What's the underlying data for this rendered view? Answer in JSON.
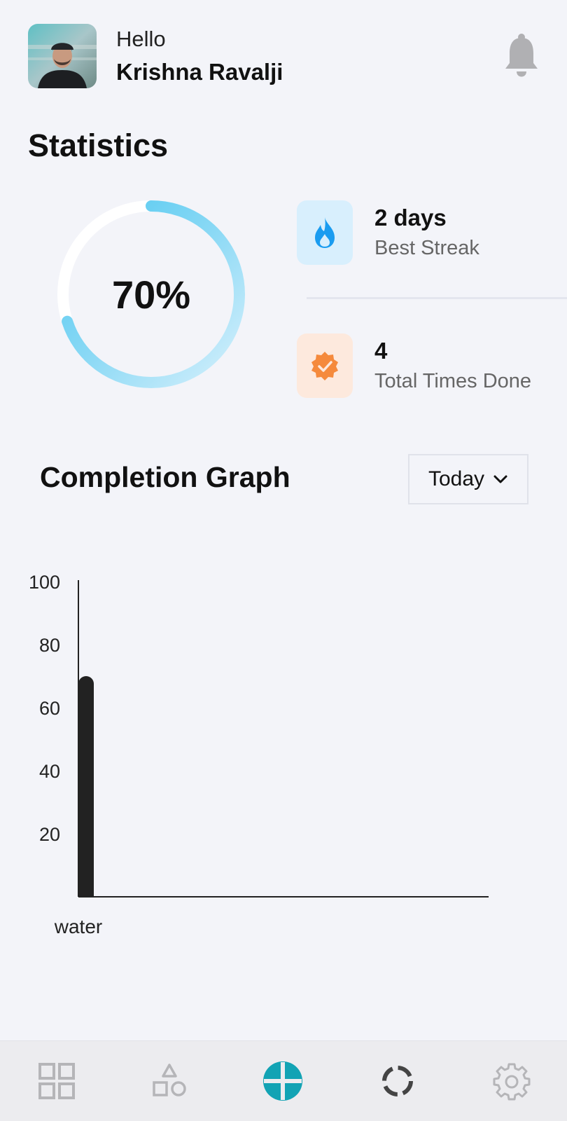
{
  "header": {
    "greeting": "Hello",
    "username": "Krishna Ravalji"
  },
  "statistics": {
    "title": "Statistics",
    "completion_percent": 70,
    "completion_label": "70%",
    "best_streak": {
      "value": "2 days",
      "label": "Best Streak",
      "icon": "flame-icon"
    },
    "total_done": {
      "value": "4",
      "label": "Total Times Done",
      "icon": "verified-badge-icon"
    }
  },
  "graph": {
    "title": "Completion Graph",
    "period_select": {
      "value": "Today",
      "icon": "chevron-down-icon"
    }
  },
  "chart_data": {
    "type": "bar",
    "categories": [
      "water"
    ],
    "values": [
      70
    ],
    "ylim": [
      0,
      100
    ],
    "yticks": [
      20,
      40,
      60,
      80,
      100
    ],
    "bar_color": "#222222",
    "grid": false
  },
  "nav": {
    "items": [
      {
        "icon": "dashboard-grid-icon",
        "active": false
      },
      {
        "icon": "shapes-icon",
        "active": false
      },
      {
        "icon": "add-circle-icon",
        "active": true
      },
      {
        "icon": "progress-ring-icon",
        "active": false
      },
      {
        "icon": "settings-gear-icon",
        "active": false
      }
    ]
  },
  "colors": {
    "background": "#f3f4f9",
    "accent_blue": "#4cc7f0",
    "accent_orange": "#f58a3c",
    "active_nav": "#12a3b4",
    "inactive_nav": "#b5b5b8"
  }
}
